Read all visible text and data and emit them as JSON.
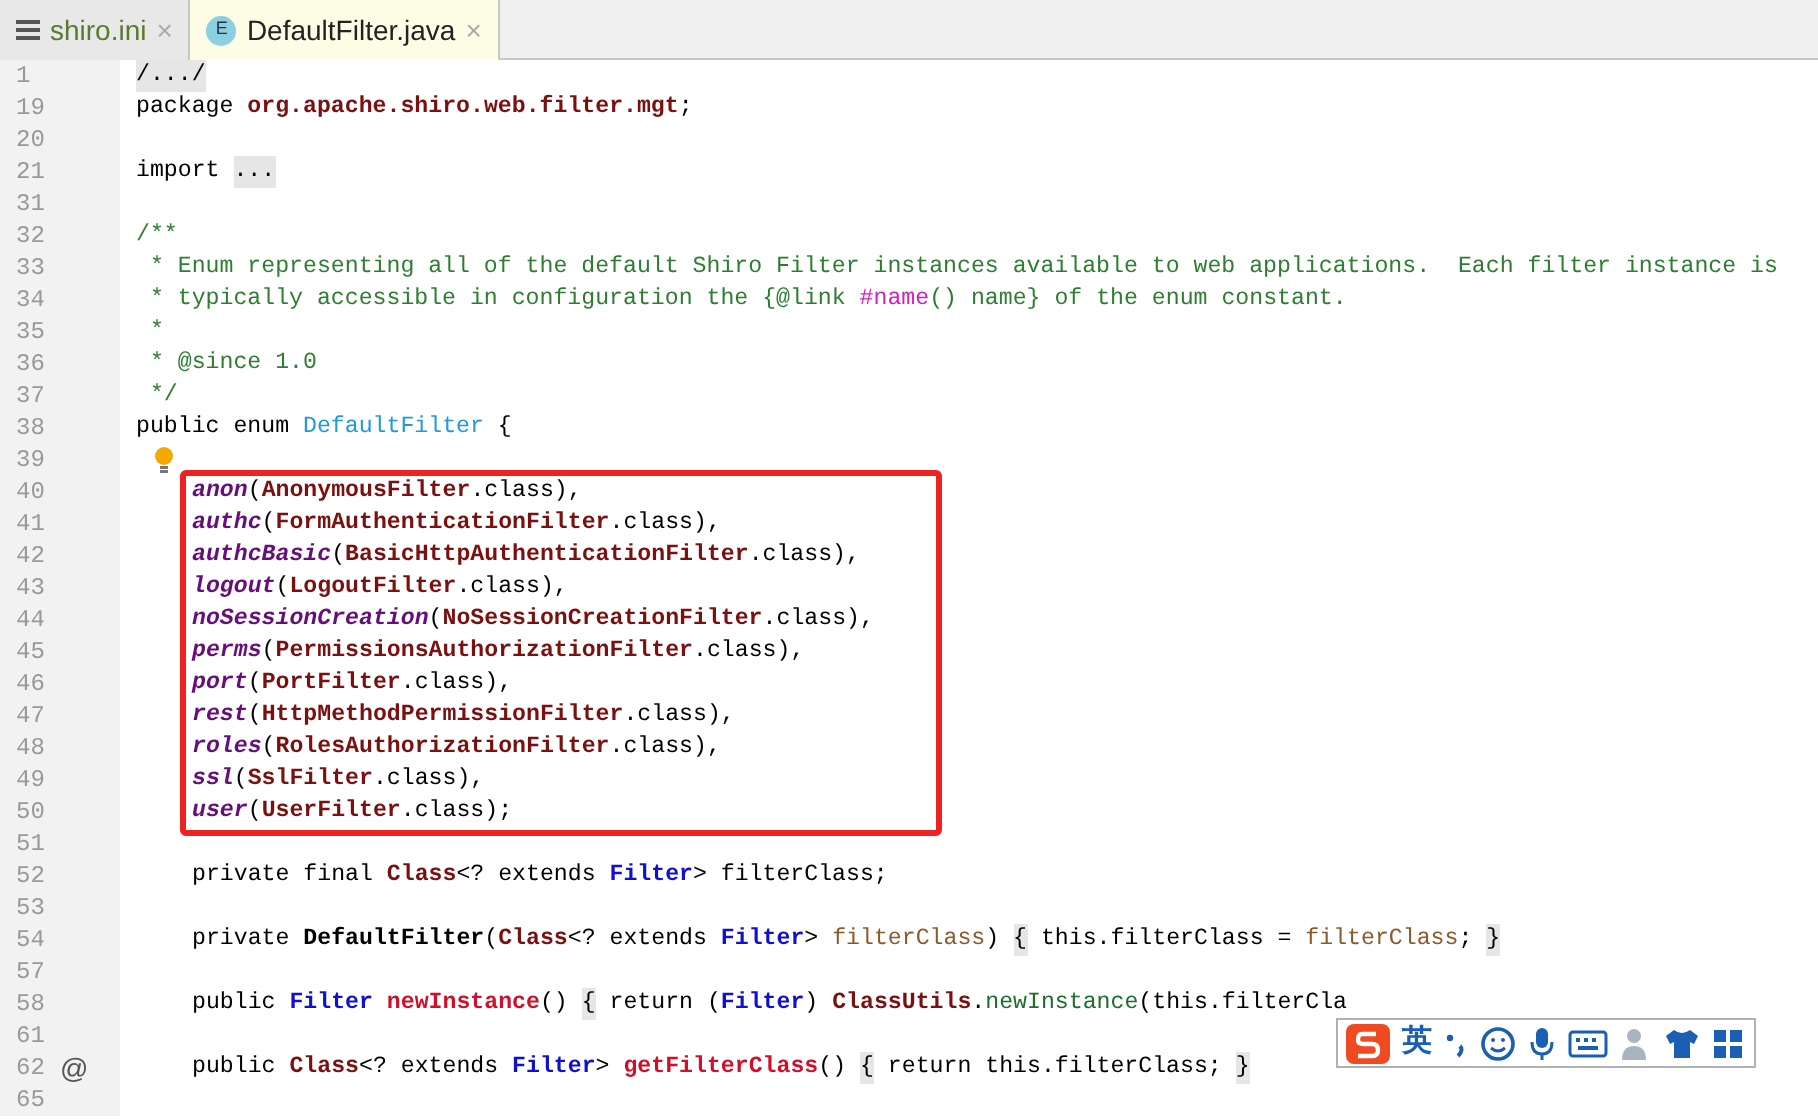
{
  "tabs": [
    {
      "label": "shiro.ini",
      "kind": "ini",
      "selected": false,
      "close": "×"
    },
    {
      "label": "DefaultFilter.java",
      "kind": "enum",
      "selected": true,
      "close": "×",
      "icon_letter": "E"
    }
  ],
  "sections": [
    {
      "boxed": false,
      "rows": [
        {
          "line": "1",
          "kind": "top",
          "tokens": [
            {
              "kind": "fold",
              "text": "/.../"
            }
          ]
        },
        {
          "line": "19",
          "kind": "top",
          "tokens": [
            {
              "kind": "text",
              "text": "package "
            },
            {
              "kind": "pkg",
              "text": "org.apache.shiro.web.filter.mgt"
            },
            {
              "kind": "text",
              "text": ";"
            }
          ]
        },
        {
          "line": "20",
          "kind": "top",
          "tokens": []
        },
        {
          "line": "21",
          "kind": "top",
          "tokens": [
            {
              "kind": "text",
              "text": "import "
            },
            {
              "kind": "fold",
              "text": "..."
            }
          ]
        },
        {
          "line": "31",
          "kind": "top",
          "tokens": []
        },
        {
          "line": "32",
          "kind": "top",
          "tokens": [
            {
              "kind": "comment",
              "text": "/**"
            }
          ]
        },
        {
          "line": "33",
          "kind": "top",
          "tokens": [
            {
              "kind": "comment",
              "text": " * Enum representing all of the default Shiro Filter instances available to web applications.  Each filter instance is"
            }
          ]
        },
        {
          "line": "34",
          "kind": "top",
          "tokens": [
            {
              "kind": "comment",
              "text": " * typically accessible in configuration the {@link "
            },
            {
              "kind": "comment-ref",
              "text": "#name"
            },
            {
              "kind": "comment",
              "text": "() name} of the enum constant."
            }
          ]
        },
        {
          "line": "35",
          "kind": "top",
          "tokens": [
            {
              "kind": "comment",
              "text": " *"
            }
          ]
        },
        {
          "line": "36",
          "kind": "top",
          "tokens": [
            {
              "kind": "comment",
              "text": " * @since 1.0"
            }
          ]
        },
        {
          "line": "37",
          "kind": "top",
          "tokens": [
            {
              "kind": "comment",
              "text": " */"
            }
          ]
        },
        {
          "line": "38",
          "kind": "top",
          "tokens": [
            {
              "kind": "text",
              "text": "public enum "
            },
            {
              "kind": "type-decl",
              "text": "DefaultFilter"
            },
            {
              "kind": "text",
              "text": " {"
            }
          ]
        },
        {
          "line": "39",
          "kind": "bulb",
          "tokens": []
        }
      ]
    },
    {
      "boxed": true,
      "rows": [
        {
          "line": "40",
          "kind": "member",
          "tokens": [
            {
              "kind": "enum-const",
              "text": "anon"
            },
            {
              "kind": "text",
              "text": "("
            },
            {
              "kind": "class-ref",
              "text": "AnonymousFilter"
            },
            {
              "kind": "text",
              "text": ".class),"
            }
          ]
        },
        {
          "line": "41",
          "kind": "member",
          "tokens": [
            {
              "kind": "enum-const",
              "text": "authc"
            },
            {
              "kind": "text",
              "text": "("
            },
            {
              "kind": "class-ref",
              "text": "FormAuthenticationFilter"
            },
            {
              "kind": "text",
              "text": ".class),"
            }
          ]
        },
        {
          "line": "42",
          "kind": "member",
          "tokens": [
            {
              "kind": "enum-const",
              "text": "authcBasic"
            },
            {
              "kind": "text",
              "text": "("
            },
            {
              "kind": "class-ref",
              "text": "BasicHttpAuthenticationFilter"
            },
            {
              "kind": "text",
              "text": ".class),"
            }
          ]
        },
        {
          "line": "43",
          "kind": "member",
          "tokens": [
            {
              "kind": "enum-const",
              "text": "logout"
            },
            {
              "kind": "text",
              "text": "("
            },
            {
              "kind": "class-ref",
              "text": "LogoutFilter"
            },
            {
              "kind": "text",
              "text": ".class),"
            }
          ]
        },
        {
          "line": "44",
          "kind": "member",
          "tokens": [
            {
              "kind": "enum-const",
              "text": "noSessionCreation"
            },
            {
              "kind": "text",
              "text": "("
            },
            {
              "kind": "class-ref",
              "text": "NoSessionCreationFilter"
            },
            {
              "kind": "text",
              "text": ".class),"
            }
          ]
        },
        {
          "line": "45",
          "kind": "member",
          "tokens": [
            {
              "kind": "enum-const",
              "text": "perms"
            },
            {
              "kind": "text",
              "text": "("
            },
            {
              "kind": "class-ref",
              "text": "PermissionsAuthorizationFilter"
            },
            {
              "kind": "text",
              "text": ".class),"
            }
          ]
        },
        {
          "line": "46",
          "kind": "member",
          "tokens": [
            {
              "kind": "enum-const",
              "text": "port"
            },
            {
              "kind": "text",
              "text": "("
            },
            {
              "kind": "class-ref",
              "text": "PortFilter"
            },
            {
              "kind": "text",
              "text": ".class),"
            }
          ]
        },
        {
          "line": "47",
          "kind": "member",
          "tokens": [
            {
              "kind": "enum-const",
              "text": "rest"
            },
            {
              "kind": "text",
              "text": "("
            },
            {
              "kind": "class-ref",
              "text": "HttpMethodPermissionFilter"
            },
            {
              "kind": "text",
              "text": ".class),"
            }
          ]
        },
        {
          "line": "48",
          "kind": "member",
          "tokens": [
            {
              "kind": "enum-const",
              "text": "roles"
            },
            {
              "kind": "text",
              "text": "("
            },
            {
              "kind": "class-ref",
              "text": "RolesAuthorizationFilter"
            },
            {
              "kind": "text",
              "text": ".class),"
            }
          ]
        },
        {
          "line": "49",
          "kind": "member",
          "tokens": [
            {
              "kind": "enum-const",
              "text": "ssl"
            },
            {
              "kind": "text",
              "text": "("
            },
            {
              "kind": "class-ref",
              "text": "SslFilter"
            },
            {
              "kind": "text",
              "text": ".class),"
            }
          ]
        },
        {
          "line": "50",
          "kind": "member",
          "tokens": [
            {
              "kind": "enum-const",
              "text": "user"
            },
            {
              "kind": "text",
              "text": "("
            },
            {
              "kind": "class-ref",
              "text": "UserFilter"
            },
            {
              "kind": "text",
              "text": ".class);"
            }
          ]
        }
      ]
    },
    {
      "boxed": false,
      "rows": [
        {
          "line": "51",
          "kind": "member",
          "tokens": []
        },
        {
          "line": "52",
          "kind": "member",
          "tokens": [
            {
              "kind": "text",
              "text": "private final "
            },
            {
              "kind": "class-ref",
              "text": "Class"
            },
            {
              "kind": "text",
              "text": "<? extends "
            },
            {
              "kind": "interface-ref",
              "text": "Filter"
            },
            {
              "kind": "text",
              "text": "> filterClass;"
            }
          ]
        },
        {
          "line": "53",
          "kind": "member",
          "tokens": []
        },
        {
          "line": "54",
          "kind": "member",
          "tokens": [
            {
              "kind": "text",
              "text": "private "
            },
            {
              "kind": "ctor-decl",
              "text": "DefaultFilter"
            },
            {
              "kind": "text",
              "text": "("
            },
            {
              "kind": "class-ref",
              "text": "Class"
            },
            {
              "kind": "text",
              "text": "<? extends "
            },
            {
              "kind": "interface-ref",
              "text": "Filter"
            },
            {
              "kind": "text",
              "text": "> "
            },
            {
              "kind": "param",
              "text": "filterClass"
            },
            {
              "kind": "text",
              "text": ") "
            },
            {
              "kind": "fold",
              "text": "{"
            },
            {
              "kind": "text",
              "text": " this.filterClass = "
            },
            {
              "kind": "param",
              "text": "filterClass"
            },
            {
              "kind": "text",
              "text": "; "
            },
            {
              "kind": "fold",
              "text": "}"
            }
          ]
        },
        {
          "line": "57",
          "kind": "member",
          "tokens": []
        },
        {
          "line": "58",
          "kind": "member",
          "tokens": [
            {
              "kind": "text",
              "text": "public "
            },
            {
              "kind": "interface-ref",
              "text": "Filter "
            },
            {
              "kind": "method-decl",
              "text": "newInstance"
            },
            {
              "kind": "text",
              "text": "() "
            },
            {
              "kind": "fold",
              "text": "{"
            },
            {
              "kind": "text",
              "text": " return ("
            },
            {
              "kind": "interface-ref",
              "text": "Filter"
            },
            {
              "kind": "text",
              "text": ") "
            },
            {
              "kind": "class-ref",
              "text": "ClassUtils"
            },
            {
              "kind": "text",
              "text": "."
            },
            {
              "kind": "static-call",
              "text": "newInstance"
            },
            {
              "kind": "text",
              "text": "(this.filterCla"
            }
          ]
        },
        {
          "line": "61",
          "kind": "member",
          "tokens": []
        },
        {
          "line": "62",
          "kind": "override",
          "gutter_text": "@",
          "tokens": [
            {
              "kind": "text",
              "text": "public "
            },
            {
              "kind": "class-ref",
              "text": "Class"
            },
            {
              "kind": "text",
              "text": "<? extends "
            },
            {
              "kind": "interface-ref",
              "text": "Filter"
            },
            {
              "kind": "text",
              "text": "> "
            },
            {
              "kind": "method-decl",
              "text": "getFilterClass"
            },
            {
              "kind": "text",
              "text": "() "
            },
            {
              "kind": "fold",
              "text": "{"
            },
            {
              "kind": "text",
              "text": " return this.filterClass; "
            },
            {
              "kind": "fold",
              "text": "}"
            }
          ]
        },
        {
          "line": "65",
          "kind": "member",
          "tokens": []
        }
      ]
    }
  ],
  "ime_bar": {
    "mode": "英"
  }
}
